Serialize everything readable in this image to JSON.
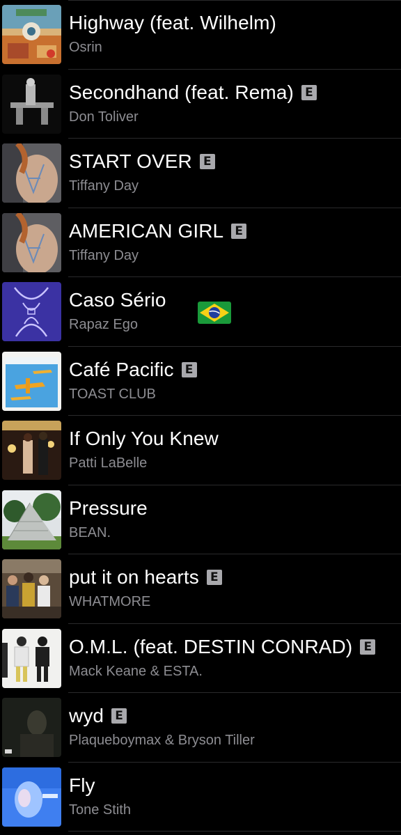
{
  "songs": [
    {
      "title": "Highway (feat. Wilhelm)",
      "artist": "Osrin",
      "explicit": false,
      "art_icon": "desert-collage-album-art"
    },
    {
      "title": "Secondhand (feat. Rema)",
      "artist": "Don Toliver",
      "explicit": true,
      "art_icon": "figure-on-black-album-art"
    },
    {
      "title": "START OVER",
      "artist": "Tiffany Day",
      "explicit": true,
      "art_icon": "back-drawing-album-art"
    },
    {
      "title": "AMERICAN GIRL",
      "artist": "Tiffany Day",
      "explicit": true,
      "art_icon": "back-drawing-album-art"
    },
    {
      "title": "Caso Sério",
      "artist": "Rapaz Ego",
      "explicit": false,
      "art_icon": "purple-figure-album-art",
      "extra_icon": "brazil-flag-icon"
    },
    {
      "title": "Café Pacific",
      "artist": "TOAST CLUB",
      "explicit": true,
      "art_icon": "airplane-album-art"
    },
    {
      "title": "If Only You Knew",
      "artist": "Patti LaBelle",
      "explicit": false,
      "art_icon": "vintage-photo-album-art"
    },
    {
      "title": "Pressure",
      "artist": "BEAN.",
      "explicit": false,
      "art_icon": "pyramid-album-art"
    },
    {
      "title": "put it on hearts",
      "artist": "WHATMORE",
      "explicit": true,
      "art_icon": "group-photo-album-art"
    },
    {
      "title": "O.M.L. (feat. DESTIN CONRAD)",
      "artist": "Mack Keane & ESTA.",
      "explicit": true,
      "art_icon": "two-figures-album-art"
    },
    {
      "title": "wyd",
      "artist": "Plaqueboymax & Bryson Tiller",
      "explicit": true,
      "art_icon": "dark-portrait-album-art"
    },
    {
      "title": "Fly",
      "artist": "Tone Stith",
      "explicit": false,
      "art_icon": "blue-portrait-album-art"
    }
  ],
  "explicit_badge": "E",
  "colors": {
    "background": "#000000",
    "title": "#ffffff",
    "artist": "#8d8d92",
    "badge": "#a9a9ad",
    "divider": "#2a2a2c"
  }
}
